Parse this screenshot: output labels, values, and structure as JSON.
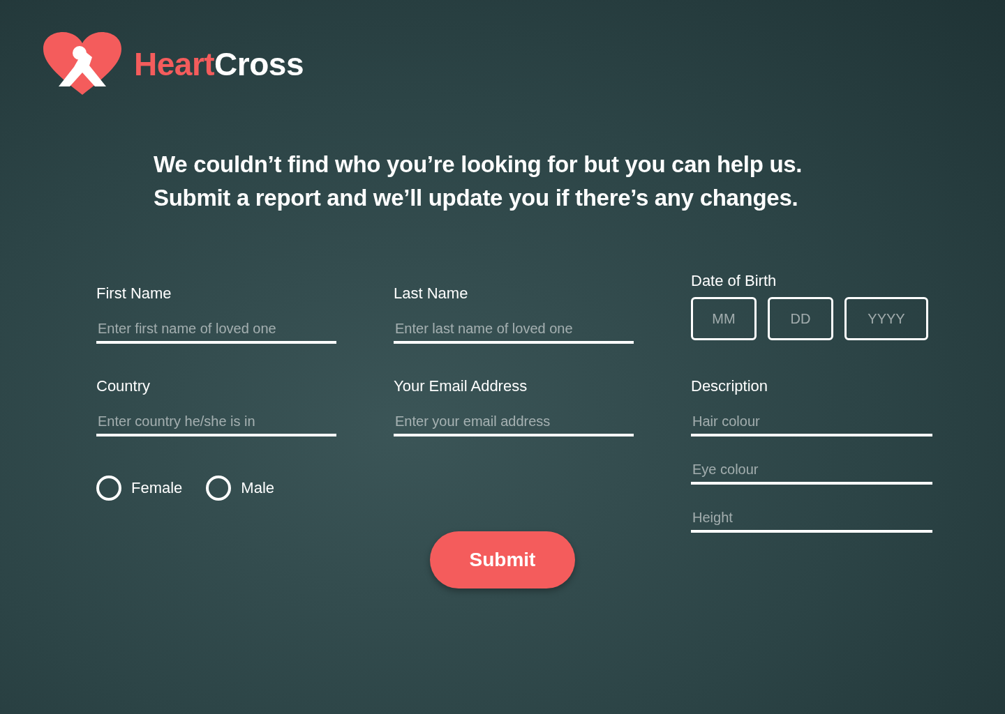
{
  "brand": {
    "first": "Heart",
    "second": "Cross"
  },
  "heading": [
    "We couldn’t find who you’re looking for but you can help us.",
    "Submit a report and we’ll update you if there’s any changes."
  ],
  "fields": [
    {
      "label": "First Name",
      "placeholder": "Enter first name of loved one"
    },
    {
      "label": "Last Name",
      "placeholder": "Enter last name of loved one"
    },
    {
      "label": "Country",
      "placeholder": "Enter country he/she is in"
    },
    {
      "label": "Your Email Address",
      "placeholder": "Enter your email address"
    }
  ],
  "dob": {
    "label": "Date of Birth",
    "boxes": [
      {
        "placeholder": "MM"
      },
      {
        "placeholder": "DD"
      },
      {
        "placeholder": "YYYY"
      }
    ]
  },
  "gender": [
    {
      "label": "Female",
      "selected": false
    },
    {
      "label": "Male",
      "selected": false
    }
  ],
  "description": {
    "label": "Description",
    "fields": [
      {
        "placeholder": "Hair colour"
      },
      {
        "placeholder": "Eye colour"
      },
      {
        "placeholder": "Height"
      }
    ]
  },
  "submit": "Submit"
}
